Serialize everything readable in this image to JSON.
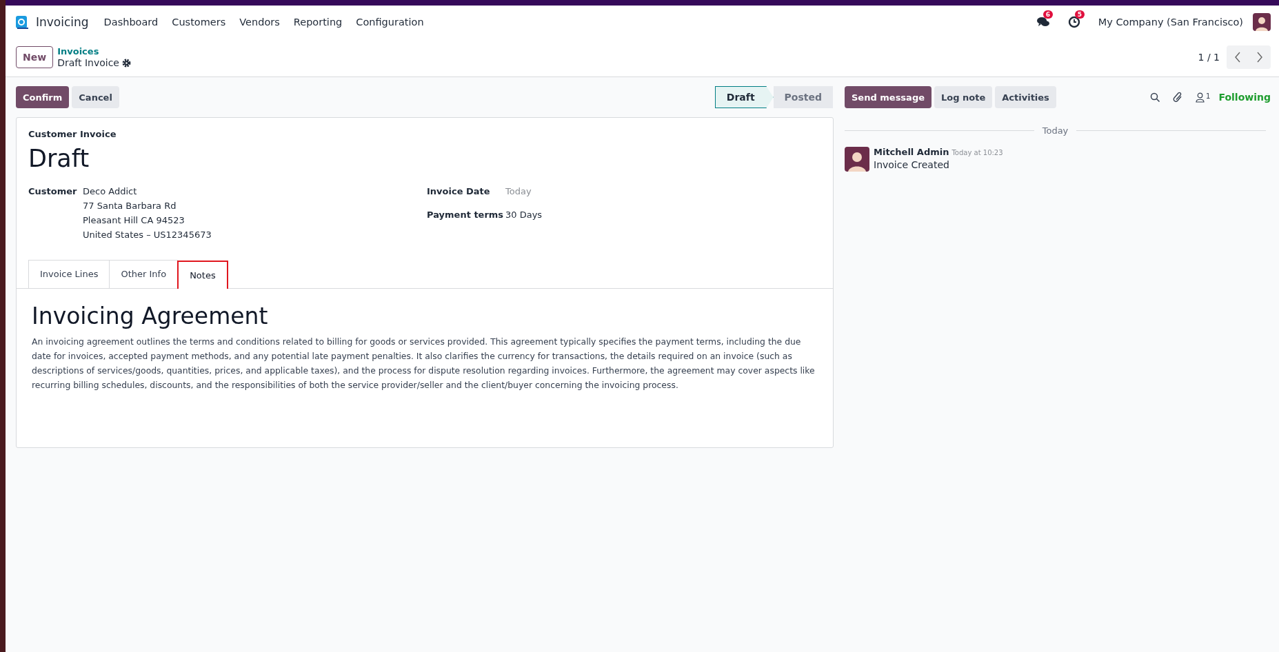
{
  "navbar": {
    "app_name": "Invoicing",
    "menu": [
      "Dashboard",
      "Customers",
      "Vendors",
      "Reporting",
      "Configuration"
    ],
    "messages_badge": "6",
    "activities_badge": "5",
    "company": "My Company (San Francisco)"
  },
  "control_panel": {
    "new_button": "New",
    "breadcrumb": "Invoices",
    "record_title": "Draft Invoice",
    "pager": "1 / 1"
  },
  "action_buttons": [
    {
      "label": "Confirm",
      "kind": "primary"
    },
    {
      "label": "Cancel",
      "kind": "secondary"
    }
  ],
  "status_steps": [
    {
      "label": "Draft",
      "selected": true
    },
    {
      "label": "Posted",
      "selected": false
    }
  ],
  "form": {
    "subtitle": "Customer Invoice",
    "title": "Draft",
    "customer_label": "Customer",
    "customer_lines": [
      "Deco Addict",
      "77 Santa Barbara Rd",
      "Pleasant Hill CA 94523",
      "United States – US12345673"
    ],
    "fields": [
      {
        "label": "Invoice Date",
        "placeholder": "Today"
      },
      {
        "label": "Payment terms",
        "value": "30 Days"
      }
    ],
    "tabs": [
      {
        "label": "Invoice Lines",
        "selected": false
      },
      {
        "label": "Other Info",
        "selected": false
      },
      {
        "label": "Notes",
        "selected": true
      }
    ],
    "notes": {
      "heading": "Invoicing Agreement",
      "body": "An invoicing agreement outlines the terms and conditions related to billing for goods or services provided. This agreement typically specifies the payment terms, including the due date for invoices, accepted payment methods, and any potential late payment penalties. It also clarifies the currency for transactions, the details required on an invoice (such as descriptions of services/goods, quantities, prices, and applicable taxes), and the process for dispute resolution regarding invoices. Furthermore, the agreement may cover aspects like recurring billing schedules, discounts, and the responsibilities of both the service provider/seller and the client/buyer concerning the invoicing process."
    }
  },
  "chatter": {
    "buttons": [
      {
        "label": "Send message",
        "kind": "primary"
      },
      {
        "label": "Log note",
        "kind": "secondary"
      },
      {
        "label": "Activities",
        "kind": "secondary"
      }
    ],
    "followers_count": "1",
    "follow_label": "Following",
    "date_separator": "Today",
    "messages": [
      {
        "author": "Mitchell Admin",
        "time": "Today at 10:23",
        "body": "Invoice Created"
      }
    ]
  }
}
